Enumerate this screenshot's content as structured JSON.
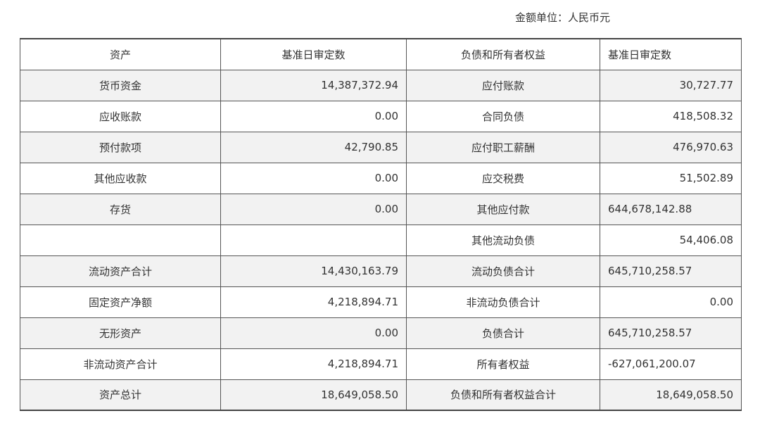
{
  "unit_label": "金额单位：人民币元",
  "table": {
    "header": [
      "资产",
      "基准日审定数",
      "负债和所有者权益",
      "基准日审定数"
    ],
    "rows": [
      {
        "asset": "货币资金",
        "asset_value": "14,387,372.94",
        "liability": "应付账款",
        "liability_value": "30,727.77",
        "liability_align": "right"
      },
      {
        "asset": "应收账款",
        "asset_value": "0.00",
        "liability": "合同负债",
        "liability_value": "418,508.32",
        "liability_align": "right"
      },
      {
        "asset": "预付款项",
        "asset_value": "42,790.85",
        "liability": "应付职工薪酬",
        "liability_value": "476,970.63",
        "liability_align": "right"
      },
      {
        "asset": "其他应收款",
        "asset_value": "0.00",
        "liability": "应交税费",
        "liability_value": "51,502.89",
        "liability_align": "right"
      },
      {
        "asset": "存货",
        "asset_value": "0.00",
        "liability": "其他应付款",
        "liability_value": "644,678,142.88",
        "liability_align": "left"
      },
      {
        "asset": "",
        "asset_value": "",
        "liability": "其他流动负债",
        "liability_value": "54,406.08",
        "liability_align": "right"
      },
      {
        "asset": "流动资产合计",
        "asset_value": "14,430,163.79",
        "liability": "流动负债合计",
        "liability_value": "645,710,258.57",
        "liability_align": "left"
      },
      {
        "asset": "固定资产净额",
        "asset_value": "4,218,894.71",
        "liability": "非流动负债合计",
        "liability_value": "0.00",
        "liability_align": "right"
      },
      {
        "asset": "无形资产",
        "asset_value": "0.00",
        "liability": "负债合计",
        "liability_value": "645,710,258.57",
        "liability_align": "left"
      },
      {
        "asset": "非流动资产合计",
        "asset_value": "4,218,894.71",
        "liability": "所有者权益",
        "liability_value": "-627,061,200.07",
        "liability_align": "left"
      },
      {
        "asset": "资产总计",
        "asset_value": "18,649,058.50",
        "liability": "负债和所有者权益合计",
        "liability_value": "18,649,058.50",
        "liability_align": "right"
      }
    ]
  }
}
